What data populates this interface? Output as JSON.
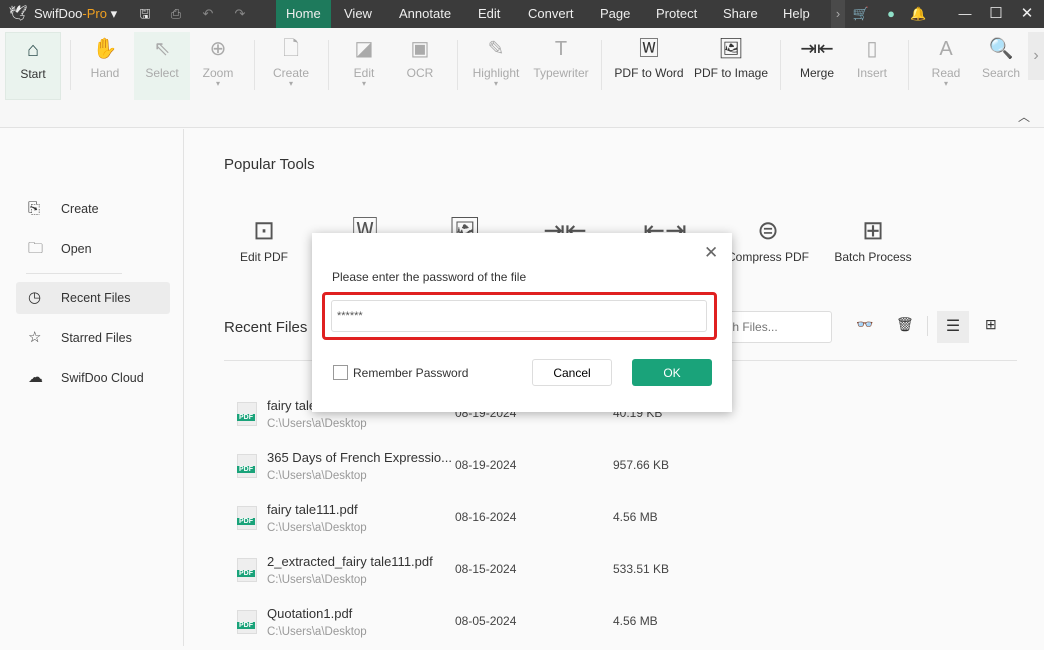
{
  "app": {
    "name": "SwifDoo",
    "edition": "-Pro"
  },
  "menu": [
    "Home",
    "View",
    "Annotate",
    "Edit",
    "Convert",
    "Page",
    "Protect",
    "Share",
    "Help"
  ],
  "ribbon": [
    {
      "label": "Start",
      "icon": "home-icon",
      "state": "active"
    },
    {
      "label": "Hand",
      "icon": "hand-icon",
      "state": "disabled"
    },
    {
      "label": "Select",
      "icon": "cursor-icon",
      "state": "selected"
    },
    {
      "label": "Zoom",
      "icon": "zoom-icon",
      "state": "disabled",
      "dropdown": true
    },
    {
      "label": "Create",
      "icon": "create-icon",
      "state": "disabled",
      "dropdown": true
    },
    {
      "label": "Edit",
      "icon": "edit-icon",
      "state": "disabled",
      "dropdown": true
    },
    {
      "label": "OCR",
      "icon": "ocr-icon",
      "state": "disabled"
    },
    {
      "label": "Highlight",
      "icon": "highlight-icon",
      "state": "disabled",
      "dropdown": true
    },
    {
      "label": "Typewriter",
      "icon": "typewriter-icon",
      "state": "disabled"
    },
    {
      "label": "PDF to Word",
      "icon": "pdf-to-word-icon",
      "state": "enabled"
    },
    {
      "label": "PDF to Image",
      "icon": "pdf-to-image-icon",
      "state": "enabled"
    },
    {
      "label": "Merge",
      "icon": "merge-icon",
      "state": "enabled"
    },
    {
      "label": "Insert",
      "icon": "insert-icon",
      "state": "disabled"
    },
    {
      "label": "Read",
      "icon": "read-icon",
      "state": "disabled",
      "dropdown": true
    },
    {
      "label": "Search",
      "icon": "search-icon",
      "state": "disabled"
    }
  ],
  "sidebar": [
    {
      "label": "Create",
      "icon": "create-icon"
    },
    {
      "label": "Open",
      "icon": "folder-icon"
    },
    {
      "label": "Recent Files",
      "icon": "clock-icon",
      "active": true
    },
    {
      "label": "Starred Files",
      "icon": "star-icon"
    },
    {
      "label": "SwifDoo Cloud",
      "icon": "cloud-icon"
    }
  ],
  "popular": {
    "title": "Popular Tools",
    "tools": [
      {
        "label": "Edit PDF",
        "icon": "edit-pdf-icon"
      },
      {
        "label": "",
        "icon": "pdf-to-word-icon"
      },
      {
        "label": "",
        "icon": "pdf-to-image-icon"
      },
      {
        "label": "",
        "icon": "merge-icon"
      },
      {
        "label": "",
        "icon": "split-icon"
      },
      {
        "label": "Compress PDF",
        "icon": "compress-icon"
      },
      {
        "label": "Batch Process",
        "icon": "batch-icon"
      }
    ]
  },
  "recent": {
    "title": "Recent Files",
    "search_placeholder": "Search Files...",
    "files": [
      {
        "name": "fairy tale",
        "path": "C:\\Users\\a\\Desktop",
        "date": "08-19-2024",
        "size": "40.19 KB"
      },
      {
        "name": "365 Days of French Expressio...",
        "path": "C:\\Users\\a\\Desktop",
        "date": "08-19-2024",
        "size": "957.66 KB"
      },
      {
        "name": "fairy tale111.pdf",
        "path": "C:\\Users\\a\\Desktop",
        "date": "08-16-2024",
        "size": "4.56 MB"
      },
      {
        "name": "2_extracted_fairy tale111.pdf",
        "path": "C:\\Users\\a\\Desktop",
        "date": "08-15-2024",
        "size": "533.51 KB"
      },
      {
        "name": "Quotation1.pdf",
        "path": "C:\\Users\\a\\Desktop",
        "date": "08-05-2024",
        "size": "4.56 MB"
      }
    ]
  },
  "dialog": {
    "prompt": "Please enter the password of the file",
    "password": "******",
    "remember": "Remember Password",
    "remember_checked": false,
    "cancel": "Cancel",
    "ok": "OK"
  },
  "colors": {
    "accent": "#1aa37a",
    "highlight_border": "#e02020",
    "titlebar": "#3b3b3b"
  }
}
